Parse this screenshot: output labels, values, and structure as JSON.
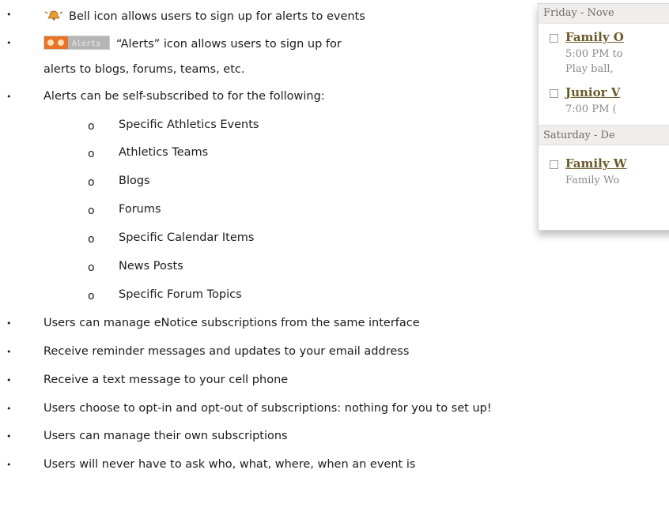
{
  "bullets_top": [
    {
      "bullet": "•",
      "icon": "bell-icon",
      "text": "Bell icon allows users to sign up for alerts to events"
    },
    {
      "bullet": "•",
      "icon": "alerts-icon",
      "icon_label": "Alerts",
      "text": "“Alerts” icon allows users to sign up for",
      "continuation": "alerts to blogs, forums, teams, etc."
    },
    {
      "bullet": "•",
      "text": "Alerts can be self-subscribed to for the following:"
    }
  ],
  "sub_marker": "o",
  "sub_items": [
    "Specific Athletics Events",
    "Athletics Teams",
    "Blogs",
    "Forums",
    "Specific Calendar Items",
    "News Posts",
    "Specific Forum Topics"
  ],
  "bullets_bottom": [
    "Users can manage eNotice subscriptions from the same interface",
    "Receive reminder messages and updates to your email address",
    "Receive a text message to your cell phone",
    "Users choose to opt-in and opt-out of subscriptions: nothing for you to set up!",
    "Users can manage their own subscriptions",
    "Users will never have to ask who, what, where, when an event is"
  ],
  "calendar": {
    "day1": "Friday - Nove",
    "event1_title": "Family O",
    "event1_time": "5:00 PM to",
    "event1_desc": "Play ball,",
    "event2_title": "Junior V",
    "event2_time": "7:00 PM (",
    "day2": "Saturday - De",
    "event3_title": "Family W",
    "event3_desc": "Family Wo"
  },
  "colors": {
    "text": "#1c1c1c",
    "alerts_icon_bg": "#e8742a",
    "bell": "#d98b20",
    "cal_link": "#6a5a2a"
  }
}
